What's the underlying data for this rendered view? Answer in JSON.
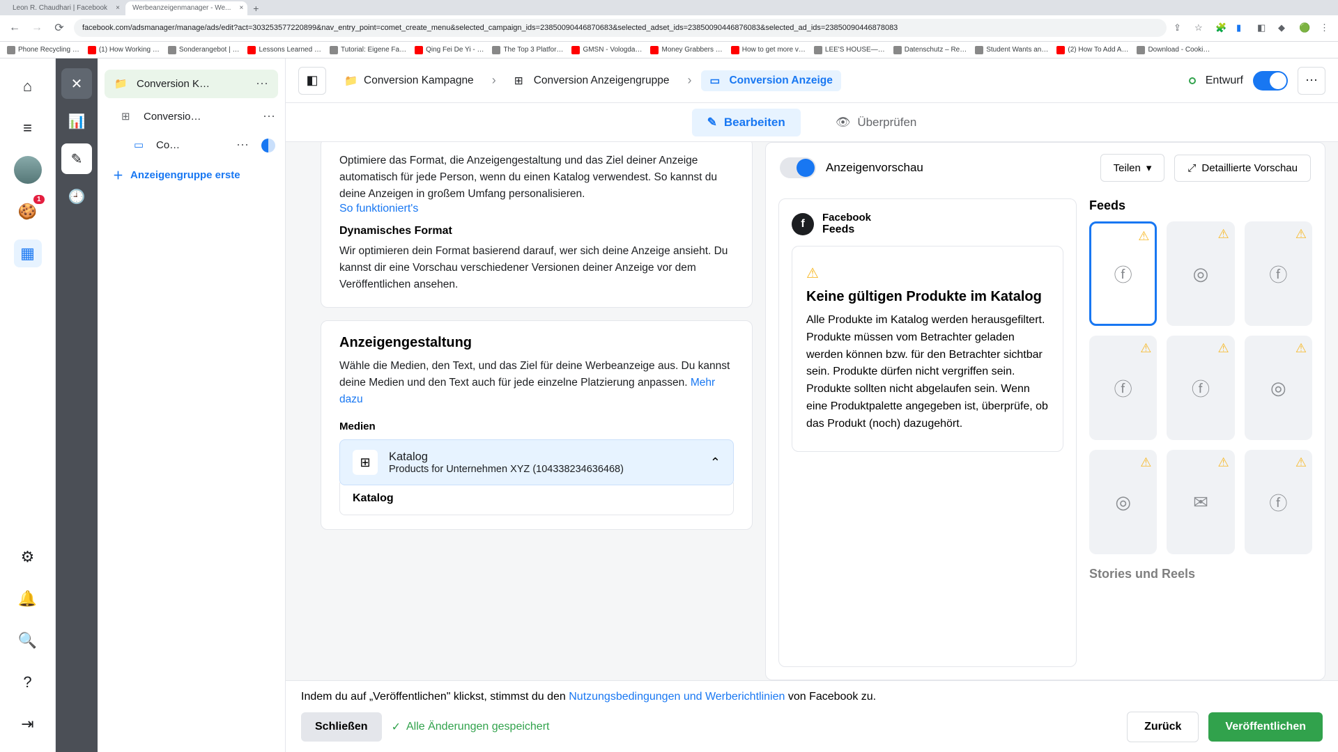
{
  "browser": {
    "tabs": [
      {
        "title": "Leon R. Chaudhari | Facebook"
      },
      {
        "title": "Werbeanzeigenmanager - We..."
      }
    ],
    "url": "facebook.com/adsmanager/manage/ads/edit?act=303253577220899&nav_entry_point=comet_create_menu&selected_campaign_ids=23850090446870683&selected_adset_ids=23850090446876083&selected_ad_ids=23850090446878083",
    "bookmarks": [
      "Phone Recycling …",
      "(1) How Working …",
      "Sonderangebot | …",
      "Lessons Learned …",
      "Tutorial: Eigene Fa…",
      "Qing Fei De Yi - …",
      "The Top 3 Platfor…",
      "GMSN - Vologda…",
      "Money Grabbers …",
      "How to get more v…",
      "LEE'S HOUSE—…",
      "Datenschutz – Re…",
      "Student Wants an…",
      "(2) How To Add A…",
      "Download - Cooki…"
    ]
  },
  "sidebar": {
    "campaign": "Conversion K…",
    "adset": "Conversio…",
    "ad": "Co…",
    "create": "Anzeigengruppe erste"
  },
  "breadcrumb": {
    "campaign": "Conversion Kampagne",
    "adset": "Conversion Anzeigengruppe",
    "ad": "Conversion Anzeige"
  },
  "header": {
    "draft": "Entwurf"
  },
  "tabs": {
    "edit": "Bearbeiten",
    "review": "Überprüfen"
  },
  "form": {
    "intro_text": "Optimiere das Format, die Anzeigengestaltung und das Ziel deiner Anzeige automatisch für jede Person, wenn du einen Katalog verwendest. So kannst du deine Anzeigen in großem Umfang personalisieren.",
    "intro_link": "So funktioniert's",
    "dyn_title": "Dynamisches Format",
    "dyn_text": "Wir optimieren dein Format basierend darauf, wer sich deine Anzeige ansieht. Du kannst dir eine Vorschau verschiedener Versionen deiner Anzeige vor dem Veröffentlichen ansehen.",
    "creative_title": "Anzeigengestaltung",
    "creative_text": "Wähle die Medien, den Text, und das Ziel für deine Werbeanzeige aus. Du kannst deine Medien und den Text auch für jede einzelne Platzierung anpassen. ",
    "creative_link": "Mehr dazu",
    "media_label": "Medien",
    "catalog_title": "Katalog",
    "catalog_sub": "Products for Unternehmen XYZ (104338234636468)",
    "catalog_inner": "Katalog"
  },
  "preview": {
    "title": "Anzeigenvorschau",
    "share": "Teilen",
    "detail": "Detaillierte Vorschau",
    "source_name": "Facebook",
    "source_sub": "Feeds",
    "error_title": "Keine gültigen Produkte im Katalog",
    "error_text": "Alle Produkte im Katalog werden herausgefiltert. Produkte müssen vom Betrachter geladen werden können bzw. für den Betrachter sichtbar sein. Produkte dürfen nicht vergriffen sein. Produkte sollten nicht abgelaufen sein. Wenn eine Produktpalette angegeben ist, überprüfe, ob das Produkt (noch) dazugehört.",
    "feeds_title": "Feeds",
    "stories_title": "Stories und Reels",
    "feed_icons": [
      "fb",
      "ig",
      "fb",
      "fb",
      "fb",
      "ig",
      "ig",
      "msg",
      "fb"
    ]
  },
  "footer": {
    "publish_text_pre": "Indem du auf „Veröffentlichen\" klickst, stimmst du den ",
    "publish_link": "Nutzungsbedingungen und Werberichtlinien",
    "publish_text_post": " von Facebook zu.",
    "close": "Schließen",
    "saved": "Alle Änderungen gespeichert",
    "back": "Zurück",
    "publish": "Veröffentlichen"
  }
}
